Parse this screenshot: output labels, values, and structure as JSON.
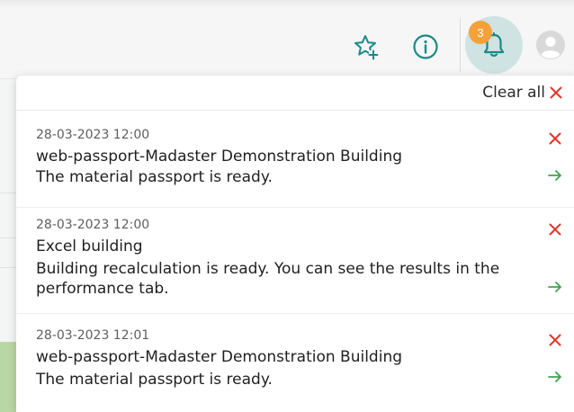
{
  "header": {
    "notification_count": "3",
    "colors": {
      "accent_teal": "#1a8a86",
      "bell_bg": "#cfe3e3",
      "badge": "#f5a13a"
    },
    "icons": [
      "star-plus-icon",
      "info-icon",
      "bell-icon",
      "user-avatar-icon"
    ]
  },
  "panel": {
    "clear_all_label": "Clear all",
    "notifications": [
      {
        "time": "28-03-2023 12:00",
        "title": "web-passport-Madaster Demonstration Building",
        "message": "The material passport is ready."
      },
      {
        "time": "28-03-2023 12:00",
        "title": "Excel building",
        "message": "Building recalculation is ready. You can see the results in the performance tab."
      },
      {
        "time": "28-03-2023 12:01",
        "title": "web-passport-Madaster Demonstration Building",
        "message": "The material passport is ready."
      }
    ],
    "colors": {
      "close": "#e5342a",
      "go": "#3fa34d"
    }
  }
}
